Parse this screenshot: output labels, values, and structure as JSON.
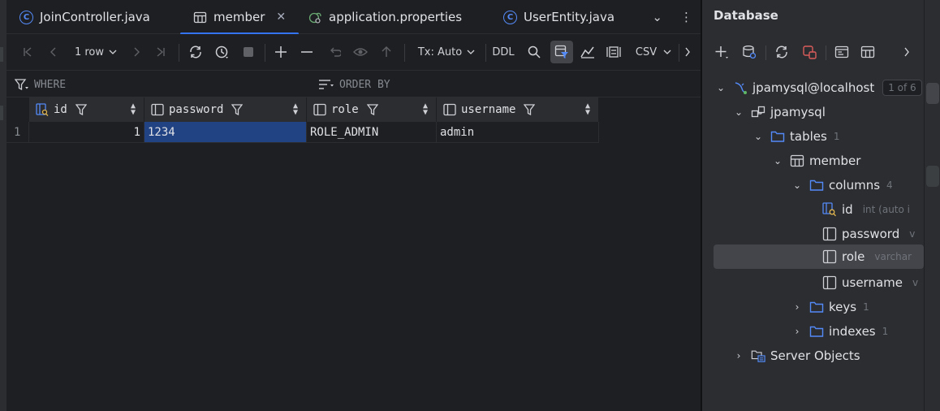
{
  "tabs": [
    {
      "label": "JoinController.java",
      "icon": "class-icon"
    },
    {
      "label": "member",
      "icon": "table-icon",
      "active": true
    },
    {
      "label": "application.properties",
      "icon": "properties-icon"
    },
    {
      "label": "UserEntity.java",
      "icon": "class-icon"
    }
  ],
  "tab_close_glyph": "✕",
  "tab_more_glyph": "⌄",
  "tab_menu_glyph": "⋮",
  "toolbar": {
    "rows_label": "1 row",
    "tx_label": "Tx: Auto",
    "ddl_label": "DDL",
    "csv_label": "CSV"
  },
  "filter": {
    "where_label": "WHERE",
    "order_label": "ORDER BY"
  },
  "grid": {
    "columns": [
      {
        "name": "id",
        "type": "key"
      },
      {
        "name": "password",
        "type": "column"
      },
      {
        "name": "role",
        "type": "column"
      },
      {
        "name": "username",
        "type": "column"
      }
    ],
    "rows": [
      {
        "num": "1",
        "id": "1",
        "password": "1234",
        "role": "ROLE_ADMIN",
        "username": "admin"
      }
    ]
  },
  "database_panel": {
    "title": "Database",
    "tree": {
      "datasource": {
        "label": "jpamysql@localhost",
        "badge": "1 of 6"
      },
      "schema": {
        "label": "jpamysql"
      },
      "tables": {
        "label": "tables",
        "count": "1"
      },
      "table": {
        "label": "member"
      },
      "columns": {
        "label": "columns",
        "count": "4"
      },
      "col_id": {
        "label": "id",
        "type": "int (auto i"
      },
      "col_password": {
        "label": "password",
        "type": "v"
      },
      "col_role": {
        "label": "role",
        "type": "varchar"
      },
      "col_username": {
        "label": "username",
        "type": "v"
      },
      "keys": {
        "label": "keys",
        "count": "1"
      },
      "indexes": {
        "label": "indexes",
        "count": "1"
      },
      "server_objects": {
        "label": "Server Objects"
      }
    }
  },
  "colors": {
    "accent": "#3574f0",
    "selection": "#214283",
    "folder": "#548af7"
  }
}
